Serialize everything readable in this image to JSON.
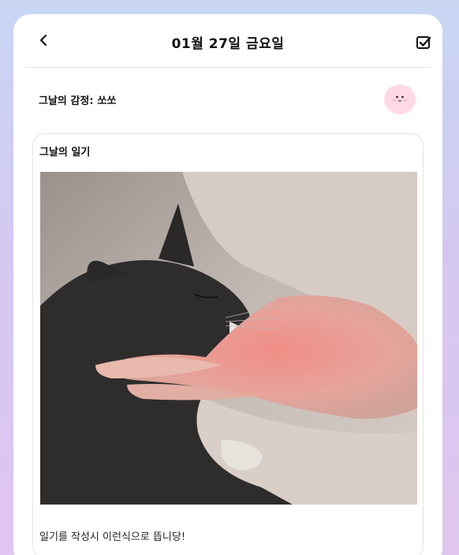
{
  "header": {
    "title": "01월 27일 금요일",
    "back_icon": "chevron-left-icon",
    "save_icon": "check-square-icon"
  },
  "emotion": {
    "label": "그날의 감정:",
    "value": "쏘쏘",
    "emoji_icon": "neutral-face-icon",
    "emoji_color": "#ffd9e3"
  },
  "diary": {
    "section_title": "그날의 일기",
    "image_alt": "cat-photo",
    "body_text": "일기를 작성시 이런식으로 뜹니당!"
  }
}
